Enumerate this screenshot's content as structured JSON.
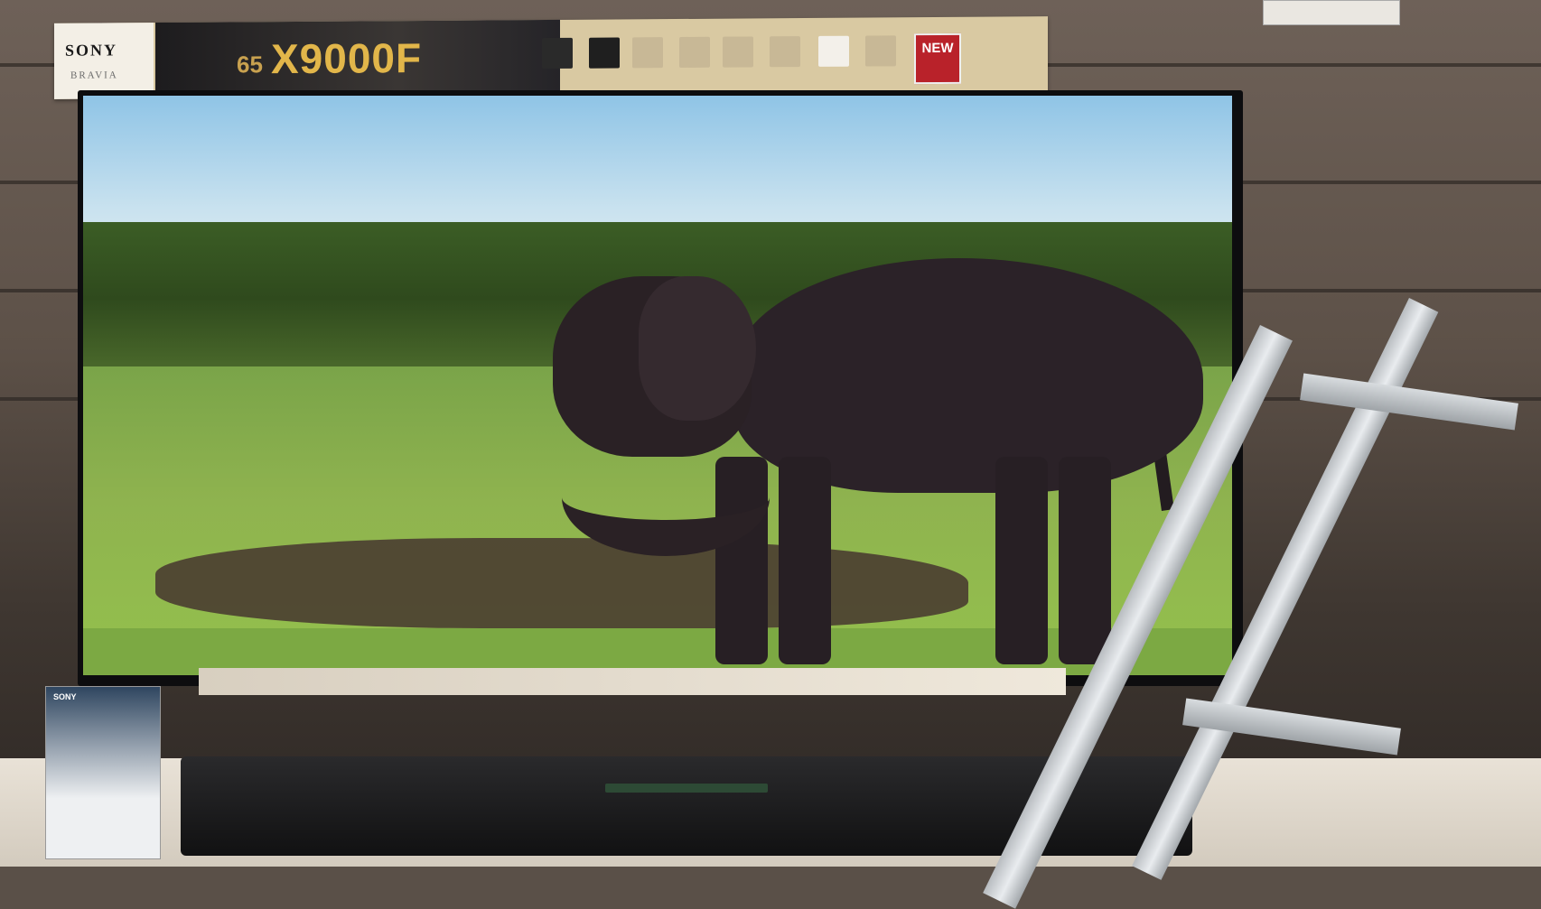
{
  "banner": {
    "brand": "SONY",
    "sub_brand": "BRAVIA",
    "size": "65",
    "model": "X9000F",
    "badge": "NEW"
  },
  "brochure": {
    "brand": "SONY"
  },
  "colors": {
    "model_gold": "#e2b64a",
    "badge_red": "#b9222a"
  }
}
